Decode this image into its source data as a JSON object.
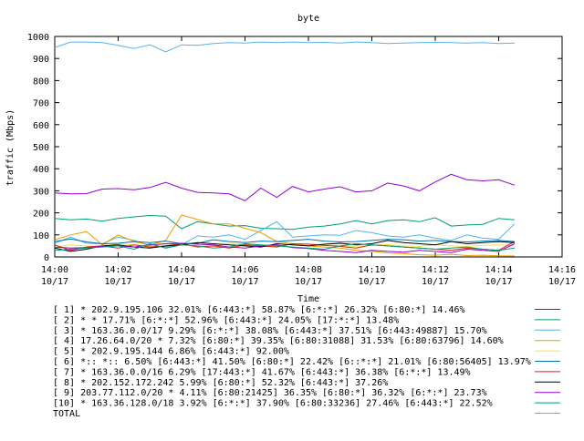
{
  "chart_data": {
    "type": "line",
    "title": "byte",
    "xlabel": "Time",
    "ylabel": "traffic (Mbps)",
    "ylim": [
      0,
      1000
    ],
    "yticks": [
      0,
      100,
      200,
      300,
      400,
      500,
      600,
      700,
      800,
      900,
      1000
    ],
    "xlim": [
      "14:00",
      "14:16"
    ],
    "xticks": [
      {
        "time": "14:00",
        "date": "10/17"
      },
      {
        "time": "14:02",
        "date": "10/17"
      },
      {
        "time": "14:04",
        "date": "10/17"
      },
      {
        "time": "14:06",
        "date": "10/17"
      },
      {
        "time": "14:08",
        "date": "10/17"
      },
      {
        "time": "14:10",
        "date": "10/17"
      },
      {
        "time": "14:12",
        "date": "10/17"
      },
      {
        "time": "14:14",
        "date": "10/17"
      },
      {
        "time": "14:16",
        "date": "10/17"
      }
    ],
    "grid": false,
    "legend_position": "bottom",
    "x": [
      "14:00",
      "14:00:30",
      "14:01",
      "14:01:30",
      "14:02",
      "14:02:30",
      "14:03",
      "14:03:30",
      "14:04",
      "14:04:30",
      "14:05",
      "14:05:30",
      "14:06",
      "14:06:30",
      "14:07",
      "14:07:30",
      "14:08",
      "14:08:30",
      "14:09",
      "14:09:30",
      "14:10",
      "14:10:30",
      "14:11",
      "14:11:30",
      "14:12",
      "14:12:30",
      "14:13",
      "14:13:30",
      "14:14",
      "14:14:30"
    ],
    "series": [
      {
        "name": "[ 1] * 202.9.195.106 32.01%  [6:443:*] 58.87% [6:*:*] 26.32% [6:80:*] 14.46%",
        "color": "#9400d3",
        "values": [
          290,
          286,
          287,
          308,
          310,
          305,
          315,
          338,
          312,
          293,
          290,
          286,
          255,
          312,
          270,
          320,
          295,
          308,
          318,
          295,
          300,
          335,
          322,
          300,
          340,
          375,
          350,
          345,
          350,
          325
        ]
      },
      {
        "name": "[ 2] * * 17.71%  [6:*:*] 52.96% [6:443:*] 24.05% [17:*:*] 13.48%",
        "color": "#009e73",
        "values": [
          175,
          168,
          172,
          162,
          175,
          182,
          188,
          185,
          128,
          160,
          150,
          140,
          142,
          130,
          128,
          125,
          135,
          140,
          150,
          165,
          150,
          165,
          168,
          160,
          178,
          140,
          145,
          148,
          175,
          168
        ]
      },
      {
        "name": "[ 3] * 163.36.0.0/17 9.29%  [6:*:*] 38.08% [6:443:*] 37.51% [6:443:49887] 15.70%",
        "color": "#56b4e9",
        "values": [
          62,
          90,
          62,
          60,
          90,
          75,
          52,
          45,
          55,
          95,
          90,
          100,
          80,
          120,
          160,
          90,
          95,
          100,
          98,
          120,
          110,
          95,
          90,
          100,
          85,
          75,
          100,
          85,
          80,
          150
        ]
      },
      {
        "name": "[ 4] 17.26.64.0/20 * 7.32%  [6:80:*] 39.35% [6:80:31088] 31.53% [6:80:63796] 14.60%",
        "color": "#e69f00",
        "values": [
          78,
          100,
          115,
          55,
          100,
          70,
          55,
          75,
          190,
          170,
          150,
          150,
          130,
          110,
          70,
          60,
          50,
          45,
          40,
          30,
          25,
          18,
          15,
          10,
          8,
          12,
          6,
          8,
          5,
          4
        ]
      },
      {
        "name": "[ 5] * 202.9.195.144 6.86%  [6:443:*] 92.00%",
        "color": "#f0e442",
        "values": [
          45,
          55,
          50,
          48,
          60,
          55,
          48,
          60,
          55,
          50,
          48,
          62,
          58,
          52,
          48,
          58,
          60,
          55,
          50,
          48,
          52,
          56,
          50,
          48,
          55,
          50,
          48,
          52,
          55,
          50
        ]
      },
      {
        "name": "[ 6] *:: *:: 6.50%  [6:443:*] 41.50% [6:80:*] 22.42% [6::*:*] 21.01% [6:80:56405] 13.97%",
        "color": "#0072b2",
        "values": [
          70,
          82,
          68,
          60,
          62,
          70,
          65,
          72,
          60,
          62,
          78,
          70,
          65,
          72,
          70,
          75,
          80,
          72,
          68,
          70,
          75,
          80,
          78,
          72,
          75,
          70,
          68,
          72,
          75,
          70
        ]
      },
      {
        "name": "[ 7] * 163.36.0.0/16 6.29%  [17:443:*] 41.67% [6:443:*] 36.38% [6:*:*] 13.49%",
        "color": "#e51e10",
        "values": [
          55,
          30,
          45,
          50,
          40,
          55,
          45,
          50,
          60,
          45,
          50,
          40,
          55,
          50,
          45,
          60,
          58,
          52,
          48,
          40,
          55,
          50,
          45,
          40,
          35,
          30,
          40,
          35,
          30,
          70
        ]
      },
      {
        "name": "[ 8] * 202.152.172.242 5.99%  [6:80:*] 52.32% [6:443:*] 37.26%",
        "color": "#000000",
        "values": [
          40,
          25,
          35,
          50,
          55,
          45,
          40,
          50,
          55,
          65,
          60,
          55,
          50,
          45,
          60,
          55,
          50,
          58,
          62,
          55,
          60,
          75,
          65,
          60,
          55,
          70,
          60,
          65,
          70,
          65
        ]
      },
      {
        "name": "[ 9] 203.77.112.0/20 * 4.11%  [6:80:21425] 36.35% [6:80:*] 36.32% [6:*:*] 23.73%",
        "color": "#9400d3",
        "values": [
          45,
          40,
          42,
          48,
          50,
          45,
          55,
          60,
          62,
          58,
          55,
          45,
          40,
          50,
          55,
          42,
          38,
          30,
          25,
          20,
          30,
          25,
          22,
          30,
          25,
          20,
          35,
          30,
          25,
          60
        ]
      },
      {
        "name": "[10] * 163.36.128.0/18 3.92%  [6:*:*] 37.90% [6:80:33236] 27.46% [6:443:*] 22.52%",
        "color": "#009e73",
        "values": [
          30,
          35,
          40,
          45,
          50,
          35,
          60,
          40,
          55,
          50,
          40,
          45,
          60,
          55,
          50,
          45,
          40,
          35,
          50,
          60,
          55,
          50,
          45,
          40,
          35,
          40,
          45,
          35,
          30,
          40
        ]
      },
      {
        "name": "TOTAL",
        "color": "#56b4e9",
        "values": [
          950,
          975,
          975,
          972,
          960,
          945,
          962,
          930,
          962,
          960,
          968,
          972,
          970,
          975,
          972,
          975,
          972,
          973,
          970,
          975,
          972,
          968,
          970,
          972,
          973,
          972,
          970,
          972,
          968,
          970
        ]
      }
    ]
  }
}
